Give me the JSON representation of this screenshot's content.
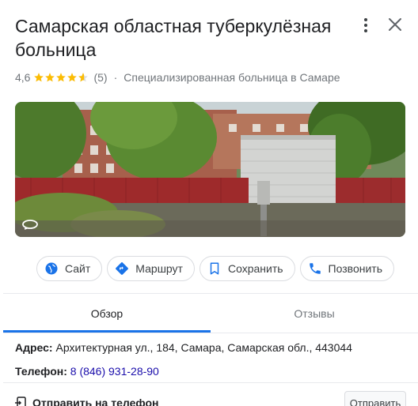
{
  "place": {
    "title": "Самарская областная туберкулёзная больница",
    "rating": "4,6",
    "stars_value": 4.6,
    "review_count": "(5)",
    "separator": "·",
    "category": "Специализированная больница в Самаре"
  },
  "actions": [
    {
      "label": "Сайт",
      "icon": "globe-icon"
    },
    {
      "label": "Маршрут",
      "icon": "directions-icon"
    },
    {
      "label": "Сохранить",
      "icon": "bookmark-icon"
    },
    {
      "label": "Позвонить",
      "icon": "phone-icon"
    }
  ],
  "tabs": [
    {
      "label": "Обзор",
      "active": true
    },
    {
      "label": "Отзывы",
      "active": false
    }
  ],
  "info": {
    "address_label": "Адрес:",
    "address_value": "Архитектурная ул., 184, Самара, Самарская обл., 443044",
    "phone_label": "Телефон:",
    "phone_value": "8 (846) 931-28-90"
  },
  "send": {
    "label": "Отправить на телефон",
    "button": "Отправить"
  },
  "colors": {
    "star": "#fbbc04",
    "accent": "#1a73e8",
    "link": "#1a0dab"
  }
}
